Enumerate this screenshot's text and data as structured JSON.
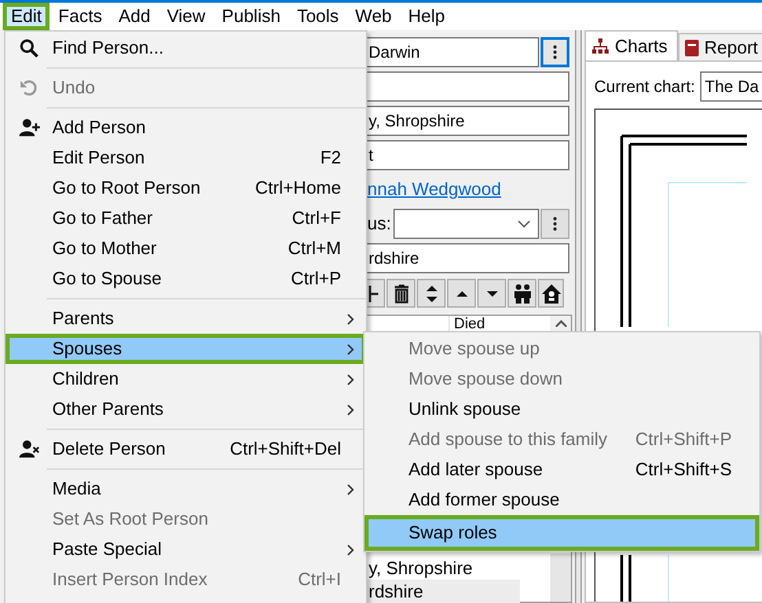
{
  "menu_bar": [
    {
      "label": "Edit",
      "selected": true
    },
    {
      "label": "Facts",
      "selected": false
    },
    {
      "label": "Add",
      "selected": false
    },
    {
      "label": "View",
      "selected": false
    },
    {
      "label": "Publish",
      "selected": false
    },
    {
      "label": "Tools",
      "selected": false
    },
    {
      "label": "Web",
      "selected": false
    },
    {
      "label": "Help",
      "selected": false
    }
  ],
  "person_panel": {
    "rows": [
      {
        "kind": "field",
        "value": "Darwin",
        "menu_button": true
      },
      {
        "kind": "field",
        "menu_button": false
      },
      {
        "kind": "field",
        "value": "y, Shropshire",
        "menu_button": false
      },
      {
        "kind": "field",
        "value": "t",
        "menu_button": false
      },
      {
        "kind": "link",
        "value": "nnah Wedgwood"
      },
      {
        "kind": "combo",
        "label": "us:",
        "menu_button": true
      },
      {
        "kind": "field",
        "value": "rdshire",
        "menu_button": false
      }
    ],
    "table": {
      "columns": [
        "Died"
      ],
      "rows": [
        {
          "cell": "y, Shropshire",
          "selected": false
        },
        {
          "cell": "rdshire",
          "selected": true
        }
      ]
    }
  },
  "chart_panel": {
    "tabs": [
      {
        "label": "Charts",
        "selected": true
      },
      {
        "label": "Report",
        "selected": false
      }
    ],
    "current_chart_label": "Current chart:",
    "current_chart": "The Da"
  },
  "edit_menu": {
    "items": [
      {
        "kind": "item",
        "label": "Find Person...",
        "disabled": false,
        "submenu": false,
        "selected": false
      },
      {
        "kind": "separator"
      },
      {
        "kind": "item",
        "label": "Undo",
        "disabled": true,
        "submenu": false,
        "selected": false
      },
      {
        "kind": "separator"
      },
      {
        "kind": "item",
        "label": "Add Person",
        "disabled": false,
        "submenu": false,
        "selected": false
      },
      {
        "kind": "item",
        "label": "Edit Person",
        "shortcut": "F2",
        "disabled": false,
        "submenu": false,
        "selected": false
      },
      {
        "kind": "item",
        "label": "Go to Root Person",
        "shortcut": "Ctrl+Home",
        "disabled": false,
        "submenu": false,
        "selected": false
      },
      {
        "kind": "item",
        "label": "Go to Father",
        "shortcut": "Ctrl+F",
        "disabled": false,
        "submenu": false,
        "selected": false
      },
      {
        "kind": "item",
        "label": "Go to Mother",
        "shortcut": "Ctrl+M",
        "disabled": false,
        "submenu": false,
        "selected": false
      },
      {
        "kind": "item",
        "label": "Go to Spouse",
        "shortcut": "Ctrl+P",
        "disabled": false,
        "submenu": false,
        "selected": false
      },
      {
        "kind": "separator"
      },
      {
        "kind": "item",
        "label": "Parents",
        "disabled": false,
        "submenu": true,
        "selected": false
      },
      {
        "kind": "item",
        "label": "Spouses",
        "disabled": false,
        "submenu": true,
        "selected": true
      },
      {
        "kind": "item",
        "label": "Children",
        "disabled": false,
        "submenu": true,
        "selected": false
      },
      {
        "kind": "item",
        "label": "Other Parents",
        "disabled": false,
        "submenu": true,
        "selected": false
      },
      {
        "kind": "separator"
      },
      {
        "kind": "item",
        "label": "Delete Person",
        "shortcut": "Ctrl+Shift+Del",
        "disabled": false,
        "submenu": false,
        "selected": false
      },
      {
        "kind": "separator"
      },
      {
        "kind": "item",
        "label": "Media",
        "disabled": false,
        "submenu": true,
        "selected": false
      },
      {
        "kind": "item",
        "label": "Set As Root Person",
        "disabled": true,
        "submenu": false,
        "selected": false
      },
      {
        "kind": "item",
        "label": "Paste Special",
        "disabled": false,
        "submenu": true,
        "selected": false
      },
      {
        "kind": "item",
        "label": "Insert Person Index",
        "shortcut": "Ctrl+I",
        "disabled": true,
        "submenu": false,
        "selected": false
      }
    ]
  },
  "spouses_submenu": {
    "items": [
      {
        "label": "Move spouse up",
        "disabled": true,
        "selected": false
      },
      {
        "label": "Move spouse down",
        "disabled": true,
        "selected": false
      },
      {
        "label": "Unlink spouse",
        "disabled": false,
        "selected": false
      },
      {
        "label": "Add spouse to this family",
        "shortcut": "Ctrl+Shift+P",
        "disabled": true,
        "selected": false
      },
      {
        "label": "Add later spouse",
        "shortcut": "Ctrl+Shift+S",
        "disabled": false,
        "selected": false
      },
      {
        "label": "Add former spouse",
        "disabled": false,
        "selected": false
      },
      {
        "label": "Swap roles",
        "disabled": false,
        "selected": true
      }
    ]
  }
}
